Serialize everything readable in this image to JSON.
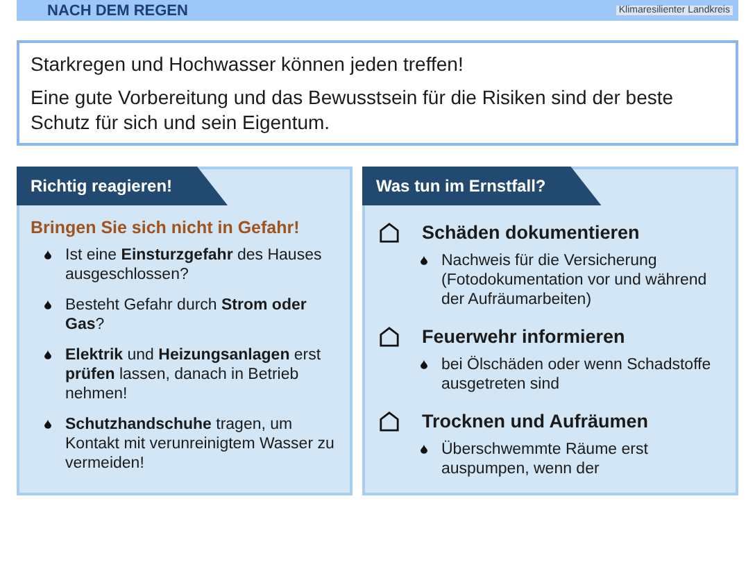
{
  "header": {
    "title": "NACH DEM REGEN",
    "logo_caption": "Klimaresilienter Landkreis"
  },
  "intro": [
    "Starkregen und Hochwasser können jeden treffen!",
    "Eine gute Vorbereitung und das Bewusstsein für die Risiken sind der beste Schutz für sich und sein Eigentum."
  ],
  "left_panel": {
    "title": "Richtig reagieren!",
    "subtitle": "Bringen Sie sich nicht in Gefahr!",
    "items": [
      "Ist eine **Einsturzgefahr** des Hauses ausgeschlossen?",
      "Besteht Gefahr durch **Strom oder Gas**?",
      "**Elektrik** und **Heizungsanlagen** erst **prüfen** lassen, danach in Betrieb nehmen!",
      "**Schutzhandschuhe** tragen, um Kontakt mit verunreinigtem Wasser zu vermeiden!"
    ]
  },
  "right_panel": {
    "title": "Was tun im Ernstfall?",
    "sections": [
      {
        "heading": "Schäden dokumentieren",
        "items": [
          "Nachweis für die Versicherung (Fotodokumentation vor und während der Aufräumarbeiten)"
        ]
      },
      {
        "heading": "Feuerwehr informieren",
        "items": [
          "bei Ölschäden oder wenn Schadstoffe ausgetreten sind"
        ]
      },
      {
        "heading": "Trocknen und Aufräumen",
        "items": [
          "Überschwemmte Räume erst auspumpen, wenn der"
        ]
      }
    ]
  }
}
